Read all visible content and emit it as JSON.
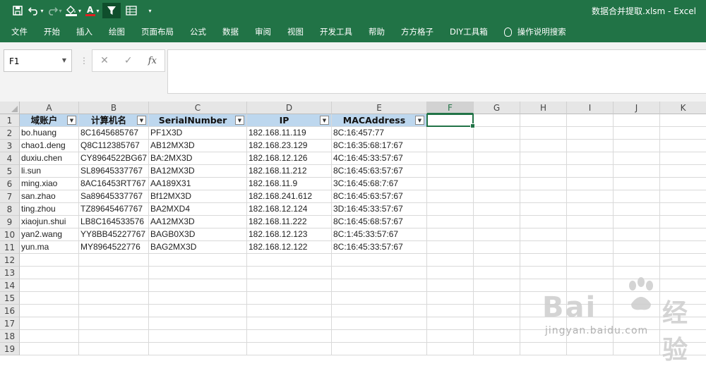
{
  "window": {
    "title": "数据合并提取.xlsm  -  Excel"
  },
  "ribbon": {
    "tabs": [
      "文件",
      "开始",
      "插入",
      "绘图",
      "页面布局",
      "公式",
      "数据",
      "审阅",
      "视图",
      "开发工具",
      "帮助",
      "方方格子",
      "DIY工具箱"
    ],
    "tell_me": "操作说明搜索"
  },
  "formula_bar": {
    "name_box": "F1",
    "formula": ""
  },
  "sheet": {
    "columns": [
      "A",
      "B",
      "C",
      "D",
      "E",
      "F",
      "G",
      "H",
      "I",
      "J",
      "K"
    ],
    "active_column": "F",
    "rows": [
      "1",
      "2",
      "3",
      "4",
      "5",
      "6",
      "7",
      "8",
      "9",
      "10",
      "11",
      "12",
      "13",
      "14",
      "15",
      "16",
      "17",
      "18",
      "19"
    ],
    "headers": [
      "域账户",
      "计算机名",
      "SerialNumber",
      "IP",
      "MACAddress"
    ],
    "data": [
      [
        "bo.huang",
        "8C1645685767",
        "PF1X3D",
        "182.168.11.119",
        "8C:16:457:77"
      ],
      [
        "chao1.deng",
        "Q8C112385767",
        "AB12MX3D",
        "182.168.23.129",
        "8C:16:35:68:17:67"
      ],
      [
        "duxiu.chen",
        "CY8964522BG67",
        "BA:2MX3D",
        "182.168.12.126",
        "4C:16:45:33:57:67"
      ],
      [
        "li.sun",
        "SL89645337767",
        "BA12MX3D",
        "182.168.11.212",
        "8C:16:45:63:57:67"
      ],
      [
        "ming.xiao",
        "8AC16453RT767",
        "AA189X31",
        "182.168.11.9",
        "3C:16:45:68:7:67"
      ],
      [
        "san.zhao",
        "Sa89645337767",
        "Bf12MX3D",
        "182.168.241.612",
        "8C:16:45:63:57:67"
      ],
      [
        "ting.zhou",
        "TZ89645467767",
        "BA2MXD4",
        "182.168.12.124",
        "3D:16:45:33:57:67"
      ],
      [
        "xiaojun.shui",
        "LB8C164533576",
        "AA12MX3D",
        "182.168.11.222",
        "8C:16:45:68:57:67"
      ],
      [
        "yan2.wang",
        "YY8BB45227767",
        "BAGB0X3D",
        "182.168.12.123",
        "8C:1:45:33:57:67"
      ],
      [
        "yun.ma",
        "MY8964522776",
        "BAG2MX3D",
        "182.168.12.122",
        "8C:16:45:33:57:67"
      ]
    ]
  },
  "watermark": {
    "brand": "Bai",
    "brand2": "经验",
    "url": "jingyan.baidu.com"
  }
}
